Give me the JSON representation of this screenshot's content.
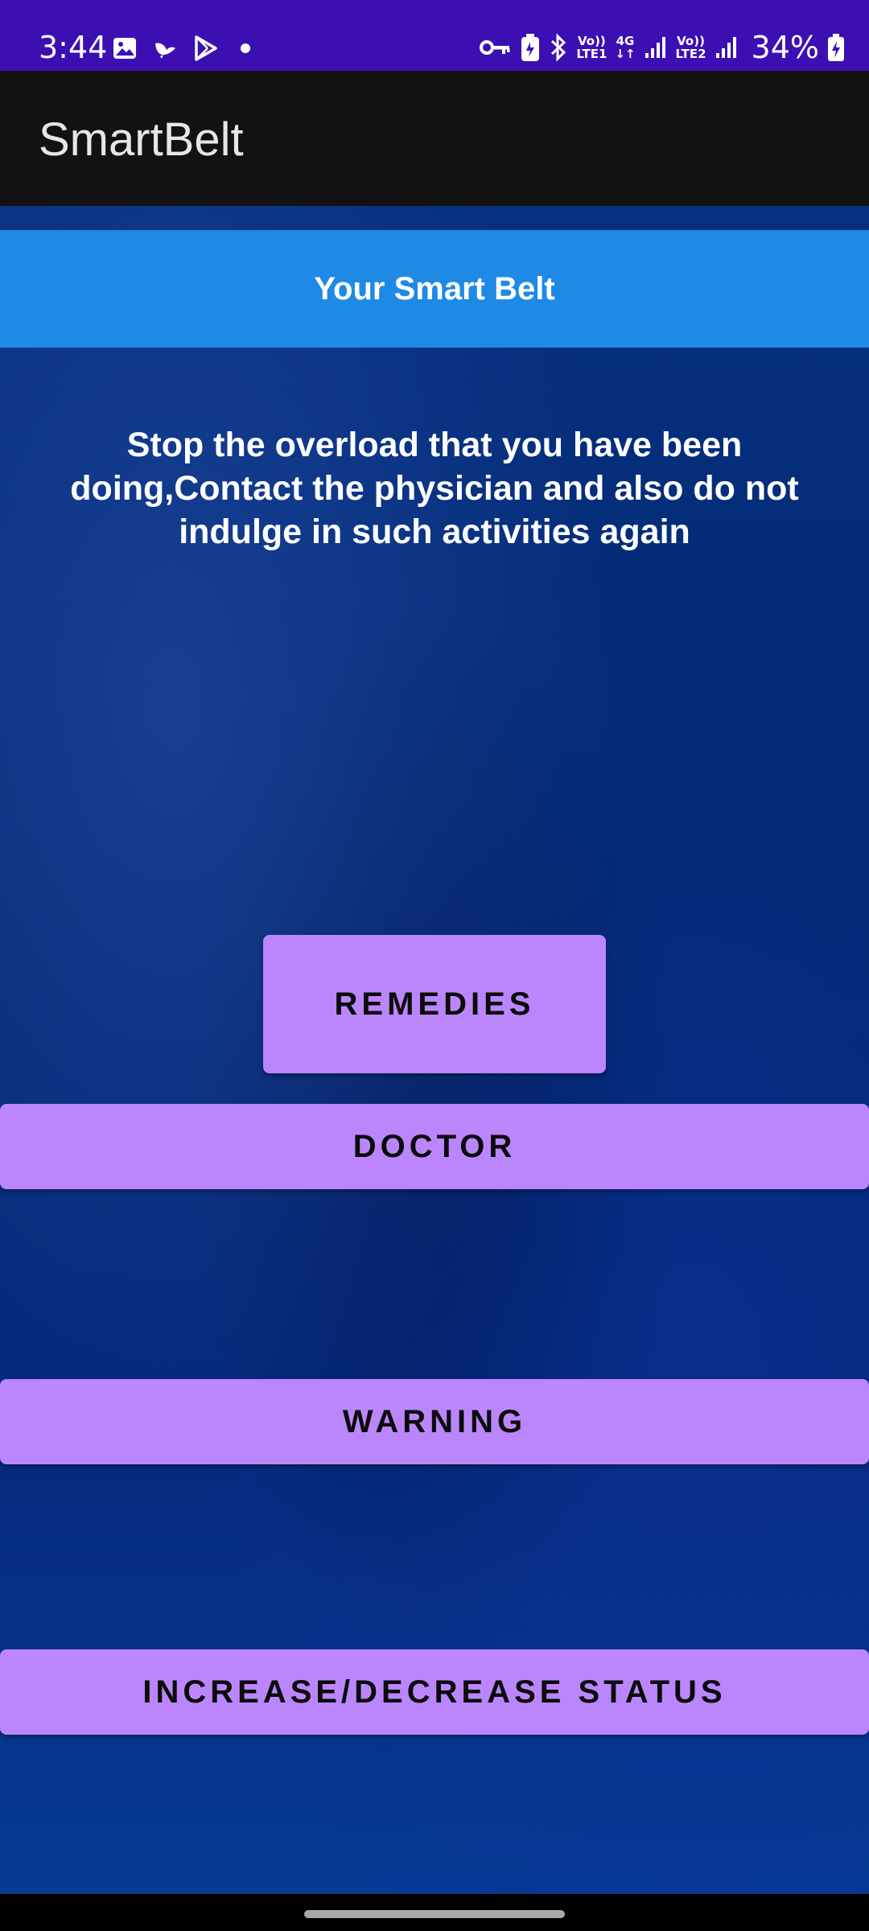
{
  "status_bar": {
    "time": "3:44",
    "left_icons": [
      "image-icon",
      "bird-icon",
      "play-store-icon",
      "dot-icon"
    ],
    "network1_top": "Vo))",
    "network1_bottom": "LTE1",
    "network_type": "4G",
    "network2_top": "Vo))",
    "network2_bottom": "LTE2",
    "battery_percent": "34%"
  },
  "app_bar": {
    "title": "SmartBelt"
  },
  "main": {
    "header": "Your Smart Belt",
    "message": "Stop the overload that you have been doing,Contact the physician and also do not indulge in such activities again",
    "buttons": {
      "remedies": "REMEDIES",
      "doctor": "DOCTOR",
      "warning": "WARNING",
      "status": "INCREASE/DECREASE STATUS"
    }
  },
  "colors": {
    "status_bar": "#3c0fb3",
    "app_bar": "#121212",
    "header_band": "#1e8ae6",
    "button": "#bb86fc"
  }
}
